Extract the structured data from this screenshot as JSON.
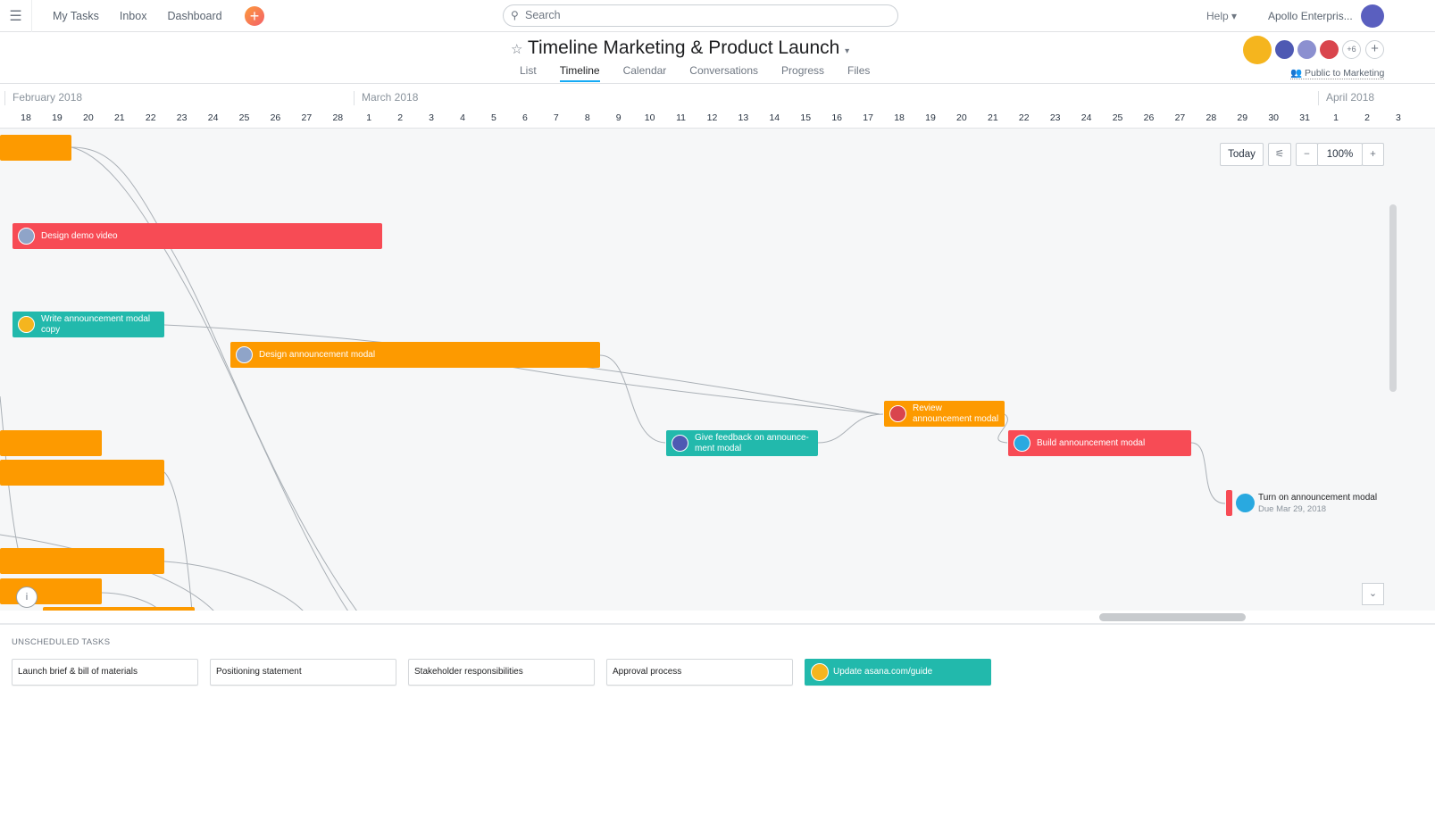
{
  "topbar": {
    "nav": [
      "My Tasks",
      "Inbox",
      "Dashboard"
    ],
    "search_placeholder": "Search",
    "help": "Help",
    "org": "Apollo Enterpris..."
  },
  "project": {
    "title": "Timeline Marketing & Product Launch",
    "tabs": [
      "List",
      "Timeline",
      "Calendar",
      "Conversations",
      "Progress",
      "Files"
    ],
    "active_tab": "Timeline",
    "members_more": "+6",
    "privacy": "Public to Marketing"
  },
  "timeline": {
    "months": [
      "February 2018",
      "March 2018",
      "April 2018"
    ],
    "days": [
      "18",
      "19",
      "20",
      "21",
      "22",
      "23",
      "24",
      "25",
      "26",
      "27",
      "28",
      "1",
      "2",
      "3",
      "4",
      "5",
      "6",
      "7",
      "8",
      "9",
      "10",
      "11",
      "12",
      "13",
      "14",
      "15",
      "16",
      "17",
      "18",
      "19",
      "20",
      "21",
      "22",
      "23",
      "24",
      "25",
      "26",
      "27",
      "28",
      "29",
      "30",
      "31",
      "1",
      "2",
      "3"
    ],
    "controls": {
      "today": "Today",
      "zoom": "100%",
      "minus": "−",
      "plus": "+"
    },
    "tasks": [
      {
        "name": "Design demo video",
        "color": "#f74b55"
      },
      {
        "name": "Write announcement modal copy",
        "color": "#22b9ac"
      },
      {
        "name": "Design announcement modal",
        "color": "#fd9a00"
      },
      {
        "name": "Give feedback on announce-ment modal",
        "color": "#22b9ac"
      },
      {
        "name": "Review announcement modal",
        "color": "#fd9a00"
      },
      {
        "name": "Build announcement modal",
        "color": "#f74b55"
      },
      {
        "name": "Turn on announcement modal",
        "due": "Due Mar 29, 2018",
        "color": "#f74b55"
      }
    ]
  },
  "unscheduled": {
    "label": "UNSCHEDULED TASKS",
    "tasks": [
      "Launch brief & bill of materials",
      "Positioning statement",
      "Stakeholder responsibilities",
      "Approval process",
      "Update asana.com/guide"
    ]
  }
}
